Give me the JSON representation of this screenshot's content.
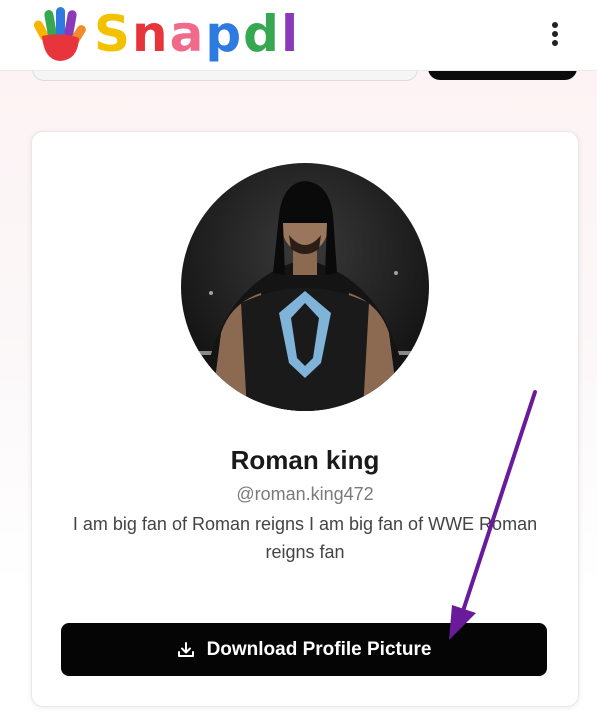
{
  "header": {
    "brand": "Snapdl",
    "logo_icon": "hand-logo-icon",
    "menu_icon": "more-vertical-icon"
  },
  "profile": {
    "name": "Roman king",
    "handle": "@roman.king472",
    "bio": "I am big fan of Roman reigns I am big fan of WWE Roman reigns fan",
    "download_label": "Download Profile Picture",
    "download_icon": "download-icon"
  },
  "colors": {
    "brand_letters": [
      "#f6b500",
      "#e8343b",
      "#2d7be0",
      "#36a852",
      "#f28b2c",
      "#8a3ab9"
    ],
    "button_bg": "#050505",
    "arrow": "#6a1b9a"
  }
}
